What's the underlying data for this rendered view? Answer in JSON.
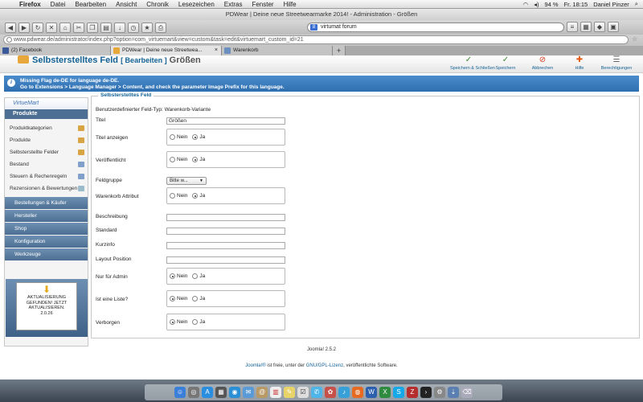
{
  "menubar": {
    "apple": "",
    "items": [
      "Firefox",
      "Datei",
      "Bearbeiten",
      "Ansicht",
      "Chronik",
      "Lesezeichen",
      "Extras",
      "Fenster",
      "Hilfe"
    ],
    "battery": "94 %",
    "clock": "Fr. 18:15",
    "user": "Daniel Pinzer"
  },
  "window": {
    "title": "PDWear | Deine neue Streetwearmarke 2014! - Administration - Größen"
  },
  "browser": {
    "search_value": "virtumat forum",
    "url": "www.pdwear.de/administrator/index.php?option=com_virtuemart&view=custom&task=edit&virtuemart_custom_id=21",
    "tabs": [
      {
        "label": "(2) Facebook",
        "color": "#3b5998"
      },
      {
        "label": "PDWear | Deine neue Streetwea...",
        "color": "#e7a73a"
      },
      {
        "label": "Warenkorb",
        "color": "#6b8fbf"
      }
    ],
    "tab_add": "+"
  },
  "header": {
    "title": "Selbsterstelltes Feld",
    "edit": "[ Bearbeiten ]",
    "subtitle": "Größen",
    "actions": [
      {
        "label": "Speichern & Schließen",
        "icon": "✓"
      },
      {
        "label": "Speichern",
        "icon": "✓"
      },
      {
        "label": "Abbrechen",
        "icon": "⊘"
      },
      {
        "label": "Hilfe",
        "icon": "✚"
      },
      {
        "label": "Berechtigungen",
        "icon": "☰"
      }
    ]
  },
  "message": {
    "line1": "Missing Flag de-DE for language de-DE.",
    "line2": "Go to Extensions > Language Manager > Content, and check the parameter Image Prefix for this language."
  },
  "sidebar": {
    "logo": "VirtueMart",
    "active_section": "Produkte",
    "subitems": [
      "Produktkategorien",
      "Produkte",
      "Selbsterstellte Felder",
      "Bestand",
      "Steuern & Rechenregeln",
      "Rezensionen & Bewertungen"
    ],
    "sections": [
      "Bestellungen & Käufer",
      "Hersteller",
      "Shop",
      "Konfiguration",
      "Werkzeuge"
    ],
    "update": {
      "line1": "AKTUALISIERUNG",
      "line2": "GEFUNDEN! JETZT",
      "line3": "AKTUALISIEREN.",
      "version": "2.0.26"
    }
  },
  "form": {
    "legend": "Selbsterstelltes Feld",
    "type_label": "Benutzerdefinierter Feld-Typ:",
    "type_value": "Warenkorb-Variante",
    "no_label": "Nein",
    "yes_label": "Ja",
    "fields": {
      "titel": {
        "label": "Titel",
        "value": "Größen"
      },
      "titel_anzeigen": {
        "label": "Titel anzeigen",
        "selected": "Ja"
      },
      "veroeffentlicht": {
        "label": "Veröffentlicht",
        "selected": "Ja"
      },
      "feldgruppe": {
        "label": "Feldgruppe",
        "value": "Bitte w..."
      },
      "warenkorb_attribut": {
        "label": "Warenkorb Attribut",
        "selected": "Ja"
      },
      "beschreibung": {
        "label": "Beschreibung",
        "value": ""
      },
      "standard": {
        "label": "Standard",
        "value": ""
      },
      "kurzinfo": {
        "label": "Kurzinfo",
        "value": ""
      },
      "layout_position": {
        "label": "Layout Position",
        "value": ""
      },
      "nur_fuer_admin": {
        "label": "Nur für Admin",
        "selected": "Nein"
      },
      "ist_eine_liste": {
        "label": "Ist eine Liste?",
        "selected": "Nein"
      },
      "verborgen": {
        "label": "Verborgen",
        "selected": "Nein"
      }
    }
  },
  "footer": {
    "version": "Joomla! 2.5.2",
    "joomla_link": "Joomla!®",
    "text_mid": " ist freie, unter der ",
    "license_link": "GNU/GPL-Lizenz",
    "text_end": ", veröffentlichte Software."
  },
  "colors": {
    "joomla_blue": "#146295",
    "message_blue": "#2f6fb0",
    "sidebar_blue": "#4d6f93"
  }
}
